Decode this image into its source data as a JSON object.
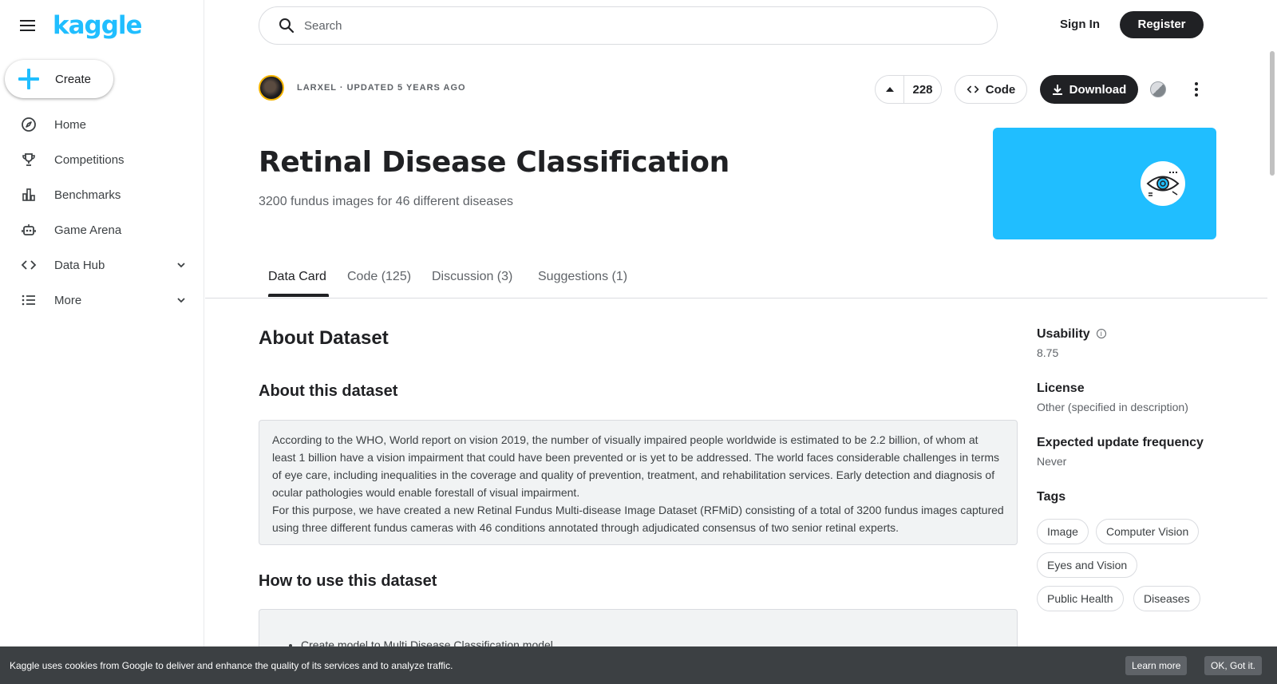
{
  "sidebar": {
    "logo": "kaggle",
    "create_label": "Create",
    "items": [
      {
        "label": "Home",
        "icon": "compass-icon"
      },
      {
        "label": "Competitions",
        "icon": "trophy-icon"
      },
      {
        "label": "Benchmarks",
        "icon": "bar-chart-icon"
      },
      {
        "label": "Game Arena",
        "icon": "robot-icon"
      },
      {
        "label": "Data Hub",
        "icon": "code-icon"
      },
      {
        "label": "More",
        "icon": "list-icon"
      }
    ]
  },
  "header": {
    "search_placeholder": "Search",
    "sign_in": "Sign In",
    "register": "Register"
  },
  "dataset": {
    "author_meta": "LARXEL · UPDATED 5 YEARS AGO",
    "vote_count": "228",
    "code_label": "Code",
    "download_label": "Download",
    "title": "Retinal Disease Classification",
    "subtitle": "3200 fundus images for 46 different diseases"
  },
  "tabs": [
    {
      "label": "Data Card"
    },
    {
      "label": "Code (125)"
    },
    {
      "label": "Discussion (3)"
    },
    {
      "label": "Suggestions (1)"
    }
  ],
  "content": {
    "about_heading": "About Dataset",
    "about_this_heading": "About this dataset",
    "description_p1": "According to the WHO, World report on vision 2019, the number of visually impaired people worldwide is estimated to be 2.2 billion, of whom at least 1 billion have a vision impairment that could have been prevented or is yet to be addressed. The world faces considerable challenges in terms of eye care, including inequalities in the coverage and quality of prevention, treatment, and rehabilitation services. Early detection and diagnosis of ocular pathologies would enable forestall of visual impairment.",
    "description_p2": "For this purpose, we have created a new Retinal Fundus Multi-disease Image Dataset (RFMiD) consisting of a total of 3200 fundus images captured using three different fundus cameras with 46 conditions annotated through adjudicated consensus of two senior retinal experts.",
    "how_to_heading": "How to use this dataset",
    "how_to_item": "Create model to Multi Disease Classification model"
  },
  "side": {
    "usability_label": "Usability",
    "usability_value": "8.75",
    "license_label": "License",
    "license_value": "Other (specified in description)",
    "frequency_label": "Expected update frequency",
    "frequency_value": "Never",
    "tags_label": "Tags",
    "tags": [
      "Image",
      "Computer Vision",
      "Eyes and Vision",
      "Public Health",
      "Diseases"
    ]
  },
  "cookie": {
    "text": "Kaggle uses cookies from Google to deliver and enhance the quality of its services and to analyze traffic.",
    "learn_more": "Learn more",
    "ok": "OK, Got it."
  },
  "colors": {
    "accent": "#20beff",
    "dark": "#202124"
  }
}
